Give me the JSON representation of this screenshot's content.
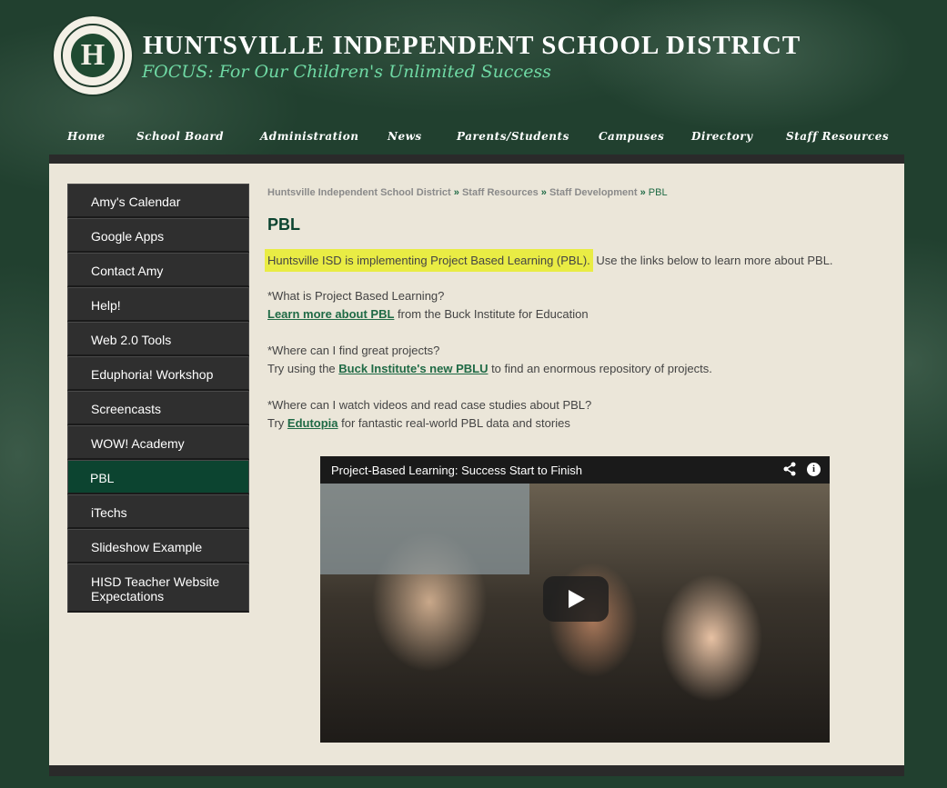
{
  "header": {
    "title": "HUNTSVILLE INDEPENDENT SCHOOL DISTRICT",
    "tagline": "FOCUS: For Our Children's Unlimited Success",
    "logo_letter": "H"
  },
  "nav": {
    "items": [
      "Home",
      "School Board",
      "Administration",
      "News",
      "Parents/Students",
      "Campuses",
      "Directory",
      "Staff Resources"
    ]
  },
  "sidebar": {
    "items": [
      {
        "label": "Amy's Calendar"
      },
      {
        "label": "Google Apps"
      },
      {
        "label": "Contact Amy"
      },
      {
        "label": "Help!"
      },
      {
        "label": "Web 2.0 Tools"
      },
      {
        "label": "Eduphoria! Workshop"
      },
      {
        "label": "Screencasts"
      },
      {
        "label": "WOW! Academy"
      },
      {
        "label": "PBL",
        "active": true
      },
      {
        "label": "iTechs"
      },
      {
        "label": "Slideshow Example"
      },
      {
        "label": "HISD Teacher Website Expectations"
      }
    ]
  },
  "breadcrumb": {
    "items": [
      "Huntsville Independent School District",
      "Staff Resources",
      "Staff Development"
    ],
    "separator": "»",
    "current": "PBL"
  },
  "main": {
    "title": "PBL",
    "intro_highlight": "Huntsville ISD is implementing Project Based Learning (PBL).",
    "intro_rest": " Use the links below to learn more about PBL.",
    "q1": "*What is Project Based Learning?",
    "q1_link": "Learn more about PBL",
    "q1_rest": " from the Buck Institute for Education",
    "q2": "*Where can I find great projects?",
    "q2_pre": "Try using the ",
    "q2_link": "Buck Institute's new PBLU",
    "q2_rest": " to find an enormous repository of projects.",
    "q3": "*Where can I watch videos and read case studies about PBL?",
    "q3_pre": "Try ",
    "q3_link": "Edutopia",
    "q3_rest": " for fantastic real-world PBL data and stories"
  },
  "video": {
    "title": "Project-Based Learning: Success Start to Finish"
  }
}
